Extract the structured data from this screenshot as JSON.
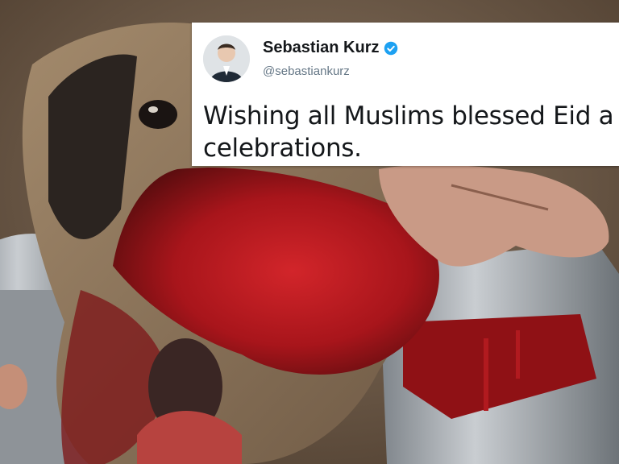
{
  "tweet": {
    "display_name": "Sebastian Kurz",
    "handle": "@sebastiankurz",
    "text": "Wishing all Muslims blessed Eid a celebrations.",
    "verified_icon": "verified-badge-icon",
    "verified_color": "#1da1f2"
  },
  "colors": {
    "card_background": "#ffffff",
    "name_color": "#14171a",
    "handle_color": "#657786",
    "blood_red": "#a8151b"
  }
}
